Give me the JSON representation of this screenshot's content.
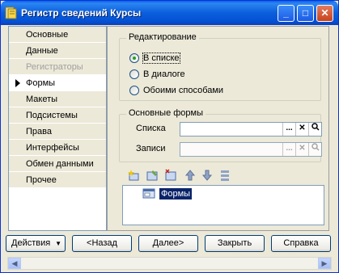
{
  "window": {
    "title": "Регистр сведений Курсы"
  },
  "titlebar_buttons": {
    "minimize": "_",
    "maximize": "□",
    "close": "✕"
  },
  "nav": {
    "items": [
      {
        "label": "Основные",
        "state": "normal"
      },
      {
        "label": "Данные",
        "state": "normal"
      },
      {
        "label": "Регистраторы",
        "state": "disabled"
      },
      {
        "label": "Формы",
        "state": "selected"
      },
      {
        "label": "Макеты",
        "state": "normal"
      },
      {
        "label": "Подсистемы",
        "state": "normal"
      },
      {
        "label": "Права",
        "state": "normal"
      },
      {
        "label": "Интерфейсы",
        "state": "normal"
      },
      {
        "label": "Обмен данными",
        "state": "normal"
      },
      {
        "label": "Прочее",
        "state": "normal"
      }
    ]
  },
  "edit_group": {
    "title": "Редактирование",
    "options": [
      {
        "label": "В списке",
        "checked": true
      },
      {
        "label": "В диалоге",
        "checked": false
      },
      {
        "label": "Обоими способами",
        "checked": false
      }
    ]
  },
  "forms_group": {
    "title": "Основные формы",
    "list_label": "Списка",
    "list_value": "",
    "record_label": "Записи",
    "record_value": "",
    "btn_select": "...",
    "btn_clear": "✕",
    "btn_open": "🔍"
  },
  "tree": {
    "root_label": "Формы"
  },
  "toolbar_icons": [
    "add-icon",
    "edit-icon",
    "delete-icon",
    "move-up-icon",
    "move-down-icon",
    "sort-icon"
  ],
  "buttons": {
    "actions": "Действия",
    "back": "<Назад",
    "next": "Далее>",
    "close": "Закрыть",
    "help": "Справка"
  },
  "colors": {
    "titlebar": "#0A5FE8",
    "selection": "#0A246A",
    "window_bg": "#ECE9D8"
  }
}
